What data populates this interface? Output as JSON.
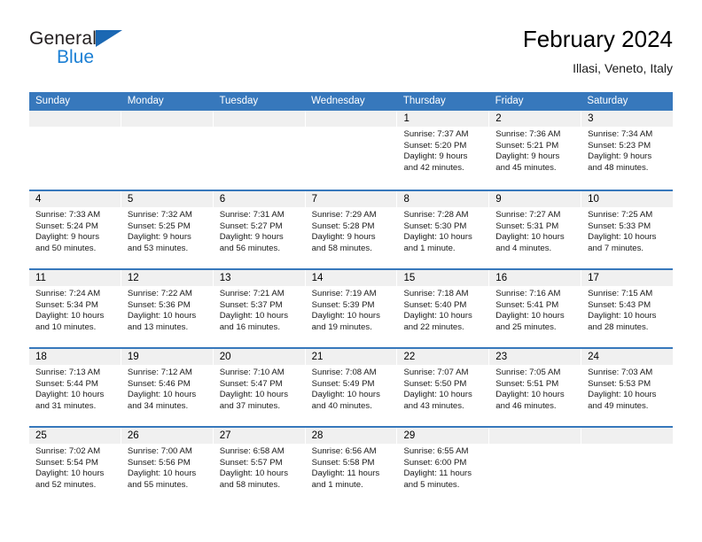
{
  "brand": {
    "name_part1": "General",
    "name_part2": "Blue",
    "triangle_color": "#1b68b3",
    "blue_color": "#1b7fd4"
  },
  "header": {
    "title": "February 2024",
    "subtitle": "Illasi, Veneto, Italy"
  },
  "theme": {
    "header_band": "#3778bc",
    "daynum_band": "#f0f0f0",
    "text": "#1a1a1a"
  },
  "weekdays": [
    "Sunday",
    "Monday",
    "Tuesday",
    "Wednesday",
    "Thursday",
    "Friday",
    "Saturday"
  ],
  "weeks": [
    [
      {
        "day": "",
        "sunrise": "",
        "sunset": "",
        "daylight1": "",
        "daylight2": ""
      },
      {
        "day": "",
        "sunrise": "",
        "sunset": "",
        "daylight1": "",
        "daylight2": ""
      },
      {
        "day": "",
        "sunrise": "",
        "sunset": "",
        "daylight1": "",
        "daylight2": ""
      },
      {
        "day": "",
        "sunrise": "",
        "sunset": "",
        "daylight1": "",
        "daylight2": ""
      },
      {
        "day": "1",
        "sunrise": "Sunrise: 7:37 AM",
        "sunset": "Sunset: 5:20 PM",
        "daylight1": "Daylight: 9 hours",
        "daylight2": "and 42 minutes."
      },
      {
        "day": "2",
        "sunrise": "Sunrise: 7:36 AM",
        "sunset": "Sunset: 5:21 PM",
        "daylight1": "Daylight: 9 hours",
        "daylight2": "and 45 minutes."
      },
      {
        "day": "3",
        "sunrise": "Sunrise: 7:34 AM",
        "sunset": "Sunset: 5:23 PM",
        "daylight1": "Daylight: 9 hours",
        "daylight2": "and 48 minutes."
      }
    ],
    [
      {
        "day": "4",
        "sunrise": "Sunrise: 7:33 AM",
        "sunset": "Sunset: 5:24 PM",
        "daylight1": "Daylight: 9 hours",
        "daylight2": "and 50 minutes."
      },
      {
        "day": "5",
        "sunrise": "Sunrise: 7:32 AM",
        "sunset": "Sunset: 5:25 PM",
        "daylight1": "Daylight: 9 hours",
        "daylight2": "and 53 minutes."
      },
      {
        "day": "6",
        "sunrise": "Sunrise: 7:31 AM",
        "sunset": "Sunset: 5:27 PM",
        "daylight1": "Daylight: 9 hours",
        "daylight2": "and 56 minutes."
      },
      {
        "day": "7",
        "sunrise": "Sunrise: 7:29 AM",
        "sunset": "Sunset: 5:28 PM",
        "daylight1": "Daylight: 9 hours",
        "daylight2": "and 58 minutes."
      },
      {
        "day": "8",
        "sunrise": "Sunrise: 7:28 AM",
        "sunset": "Sunset: 5:30 PM",
        "daylight1": "Daylight: 10 hours",
        "daylight2": "and 1 minute."
      },
      {
        "day": "9",
        "sunrise": "Sunrise: 7:27 AM",
        "sunset": "Sunset: 5:31 PM",
        "daylight1": "Daylight: 10 hours",
        "daylight2": "and 4 minutes."
      },
      {
        "day": "10",
        "sunrise": "Sunrise: 7:25 AM",
        "sunset": "Sunset: 5:33 PM",
        "daylight1": "Daylight: 10 hours",
        "daylight2": "and 7 minutes."
      }
    ],
    [
      {
        "day": "11",
        "sunrise": "Sunrise: 7:24 AM",
        "sunset": "Sunset: 5:34 PM",
        "daylight1": "Daylight: 10 hours",
        "daylight2": "and 10 minutes."
      },
      {
        "day": "12",
        "sunrise": "Sunrise: 7:22 AM",
        "sunset": "Sunset: 5:36 PM",
        "daylight1": "Daylight: 10 hours",
        "daylight2": "and 13 minutes."
      },
      {
        "day": "13",
        "sunrise": "Sunrise: 7:21 AM",
        "sunset": "Sunset: 5:37 PM",
        "daylight1": "Daylight: 10 hours",
        "daylight2": "and 16 minutes."
      },
      {
        "day": "14",
        "sunrise": "Sunrise: 7:19 AM",
        "sunset": "Sunset: 5:39 PM",
        "daylight1": "Daylight: 10 hours",
        "daylight2": "and 19 minutes."
      },
      {
        "day": "15",
        "sunrise": "Sunrise: 7:18 AM",
        "sunset": "Sunset: 5:40 PM",
        "daylight1": "Daylight: 10 hours",
        "daylight2": "and 22 minutes."
      },
      {
        "day": "16",
        "sunrise": "Sunrise: 7:16 AM",
        "sunset": "Sunset: 5:41 PM",
        "daylight1": "Daylight: 10 hours",
        "daylight2": "and 25 minutes."
      },
      {
        "day": "17",
        "sunrise": "Sunrise: 7:15 AM",
        "sunset": "Sunset: 5:43 PM",
        "daylight1": "Daylight: 10 hours",
        "daylight2": "and 28 minutes."
      }
    ],
    [
      {
        "day": "18",
        "sunrise": "Sunrise: 7:13 AM",
        "sunset": "Sunset: 5:44 PM",
        "daylight1": "Daylight: 10 hours",
        "daylight2": "and 31 minutes."
      },
      {
        "day": "19",
        "sunrise": "Sunrise: 7:12 AM",
        "sunset": "Sunset: 5:46 PM",
        "daylight1": "Daylight: 10 hours",
        "daylight2": "and 34 minutes."
      },
      {
        "day": "20",
        "sunrise": "Sunrise: 7:10 AM",
        "sunset": "Sunset: 5:47 PM",
        "daylight1": "Daylight: 10 hours",
        "daylight2": "and 37 minutes."
      },
      {
        "day": "21",
        "sunrise": "Sunrise: 7:08 AM",
        "sunset": "Sunset: 5:49 PM",
        "daylight1": "Daylight: 10 hours",
        "daylight2": "and 40 minutes."
      },
      {
        "day": "22",
        "sunrise": "Sunrise: 7:07 AM",
        "sunset": "Sunset: 5:50 PM",
        "daylight1": "Daylight: 10 hours",
        "daylight2": "and 43 minutes."
      },
      {
        "day": "23",
        "sunrise": "Sunrise: 7:05 AM",
        "sunset": "Sunset: 5:51 PM",
        "daylight1": "Daylight: 10 hours",
        "daylight2": "and 46 minutes."
      },
      {
        "day": "24",
        "sunrise": "Sunrise: 7:03 AM",
        "sunset": "Sunset: 5:53 PM",
        "daylight1": "Daylight: 10 hours",
        "daylight2": "and 49 minutes."
      }
    ],
    [
      {
        "day": "25",
        "sunrise": "Sunrise: 7:02 AM",
        "sunset": "Sunset: 5:54 PM",
        "daylight1": "Daylight: 10 hours",
        "daylight2": "and 52 minutes."
      },
      {
        "day": "26",
        "sunrise": "Sunrise: 7:00 AM",
        "sunset": "Sunset: 5:56 PM",
        "daylight1": "Daylight: 10 hours",
        "daylight2": "and 55 minutes."
      },
      {
        "day": "27",
        "sunrise": "Sunrise: 6:58 AM",
        "sunset": "Sunset: 5:57 PM",
        "daylight1": "Daylight: 10 hours",
        "daylight2": "and 58 minutes."
      },
      {
        "day": "28",
        "sunrise": "Sunrise: 6:56 AM",
        "sunset": "Sunset: 5:58 PM",
        "daylight1": "Daylight: 11 hours",
        "daylight2": "and 1 minute."
      },
      {
        "day": "29",
        "sunrise": "Sunrise: 6:55 AM",
        "sunset": "Sunset: 6:00 PM",
        "daylight1": "Daylight: 11 hours",
        "daylight2": "and 5 minutes."
      },
      {
        "day": "",
        "sunrise": "",
        "sunset": "",
        "daylight1": "",
        "daylight2": ""
      },
      {
        "day": "",
        "sunrise": "",
        "sunset": "",
        "daylight1": "",
        "daylight2": ""
      }
    ]
  ]
}
